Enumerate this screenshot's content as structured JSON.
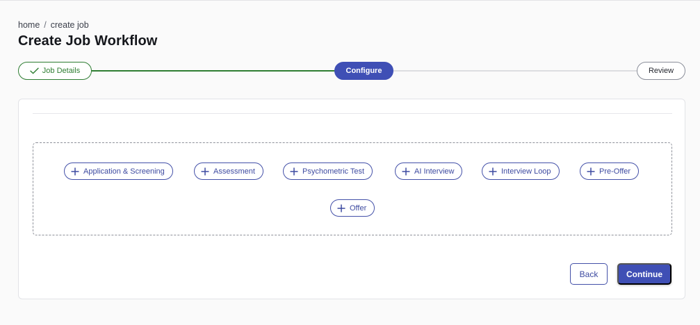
{
  "breadcrumb": {
    "home": "home",
    "separator": "/",
    "current": "create job"
  },
  "page_title": "Create Job Workflow",
  "stepper": {
    "steps": [
      {
        "label": "Job Details",
        "state": "complete",
        "icon": "check-icon"
      },
      {
        "label": "Configure",
        "state": "active"
      },
      {
        "label": "Review",
        "state": "pending"
      }
    ]
  },
  "stages": [
    {
      "label": "Application & Screening",
      "icon": "plus-icon"
    },
    {
      "label": "Assessment",
      "icon": "plus-icon"
    },
    {
      "label": "Psychometric Test",
      "icon": "plus-icon"
    },
    {
      "label": "AI Interview",
      "icon": "plus-icon"
    },
    {
      "label": "Interview Loop",
      "icon": "plus-icon"
    },
    {
      "label": "Pre-Offer",
      "icon": "plus-icon"
    },
    {
      "label": "Offer",
      "icon": "plus-icon"
    }
  ],
  "actions": {
    "back_label": "Back",
    "continue_label": "Continue"
  },
  "colors": {
    "primary": "#3f4fb5",
    "success": "#2e7d32",
    "border": "#e2e3e7"
  }
}
